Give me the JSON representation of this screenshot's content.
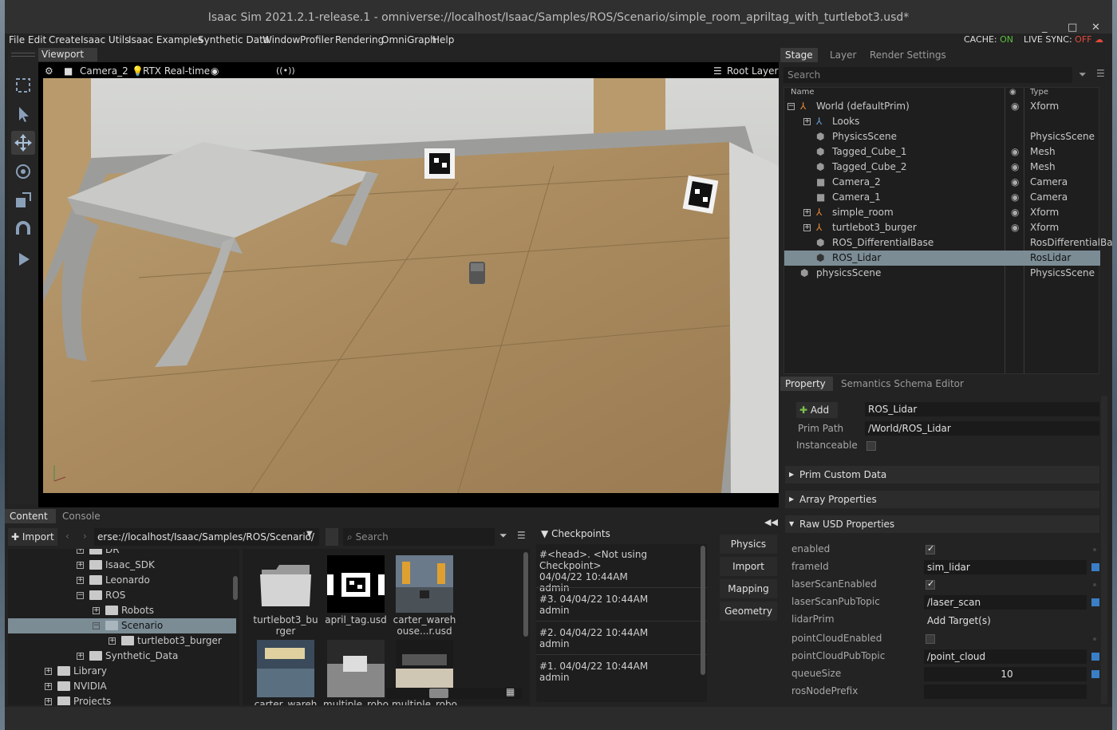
{
  "window": {
    "title": "Isaac Sim 2021.2.1-release.1 - omniverse://localhost/Isaac/Samples/ROS/Scenario/simple_room_apriltag_with_turtlebot3.usd*",
    "minimize": "_",
    "maximize": "□",
    "close": "✕"
  },
  "menu": [
    "File",
    "Edit",
    "Create",
    "Isaac Utils",
    "Isaac Examples",
    "Synthetic Data",
    "Window",
    "Profiler",
    "Rendering",
    "OmniGraph",
    "Help"
  ],
  "status": {
    "cache_label": "CACHE:",
    "cache_value": "ON",
    "live_label": "LIVE SYNC:",
    "live_value": "OFF"
  },
  "viewport": {
    "tab": "Viewport",
    "camera": "Camera_2",
    "renderer": "RTX Real-time",
    "layer": "Root Layer",
    "audio": "((•))"
  },
  "stage": {
    "tabs": [
      "Stage",
      "Layer",
      "Render Settings"
    ],
    "search_placeholder": "Search",
    "col_name": "Name",
    "col_type": "Type",
    "rows": [
      {
        "name": "World (defaultPrim)",
        "type": "Xform"
      },
      {
        "name": "Looks",
        "type": ""
      },
      {
        "name": "PhysicsScene",
        "type": "PhysicsScene"
      },
      {
        "name": "Tagged_Cube_1",
        "type": "Mesh"
      },
      {
        "name": "Tagged_Cube_2",
        "type": "Mesh"
      },
      {
        "name": "Camera_2",
        "type": "Camera"
      },
      {
        "name": "Camera_1",
        "type": "Camera"
      },
      {
        "name": "simple_room",
        "type": "Xform"
      },
      {
        "name": "turtlebot3_burger",
        "type": "Xform"
      },
      {
        "name": "ROS_DifferentialBase",
        "type": "RosDifferentialBa"
      },
      {
        "name": "ROS_Lidar",
        "type": "RosLidar"
      },
      {
        "name": "physicsScene",
        "type": "PhysicsScene"
      }
    ]
  },
  "property": {
    "tabs": [
      "Property",
      "Semantics Schema Editor"
    ],
    "add_label": "Add",
    "name_value": "ROS_Lidar",
    "prim_path_label": "Prim Path",
    "prim_path_value": "/World/ROS_Lidar",
    "instanceable_label": "Instanceable",
    "sections": [
      "Prim Custom Data",
      "Array Properties",
      "Raw USD Properties"
    ],
    "raw": {
      "enabled": "enabled",
      "frameId": "frameId",
      "frameId_value": "sim_lidar",
      "laserScanEnabled": "laserScanEnabled",
      "laserScanPubTopic": "laserScanPubTopic",
      "laserScanPubTopic_value": "/laser_scan",
      "lidarPrim": "lidarPrim",
      "lidarPrim_value": "Add Target(s)",
      "pointCloudEnabled": "pointCloudEnabled",
      "pointCloudPubTopic": "pointCloudPubTopic",
      "pointCloudPubTopic_value": "/point_cloud",
      "queueSize": "queueSize",
      "queueSize_value": "10",
      "rosNodePrefix": "rosNodePrefix"
    }
  },
  "content": {
    "tabs": [
      "Content",
      "Console"
    ],
    "import_label": "Import",
    "path": "erse://localhost/Isaac/Samples/ROS/Scenario/",
    "search_placeholder": "Search",
    "tree": [
      "DR",
      "Isaac_SDK",
      "Leonardo",
      "ROS",
      "Robots",
      "Scenario",
      "turtlebot3_burger",
      "Synthetic_Data",
      "Library",
      "NVIDIA",
      "Projects"
    ],
    "files": [
      {
        "name": "turtlebot3_bu\nrger"
      },
      {
        "name": "april_tag.usd"
      },
      {
        "name": "carter_wareh\nouse...r.usd"
      },
      {
        "name": "carter_wareh"
      },
      {
        "name": "multiple_robo"
      },
      {
        "name": "multiple_robo"
      }
    ]
  },
  "checkpoints": {
    "title": "Checkpoints",
    "items": [
      {
        "line1": "#<head>.   <Not using Checkpoint>",
        "line2": "04/04/22 10:44AM",
        "line3": "admin"
      },
      {
        "line1": "#3.   04/04/22 10:44AM",
        "line2": "admin",
        "line3": ""
      },
      {
        "line1": "#2.   04/04/22 10:44AM",
        "line2": "admin",
        "line3": ""
      },
      {
        "line1": "#1.   04/04/22 10:44AM",
        "line2": "admin",
        "line3": ""
      }
    ]
  },
  "side_buttons": [
    "Physics",
    "Import",
    "Mapping",
    "Geometry"
  ],
  "colors": {
    "accent_blue": "#3a7ec6",
    "selection": "#7b8c95",
    "on_green": "#5bbf3c",
    "off_red": "#e04a3c"
  }
}
